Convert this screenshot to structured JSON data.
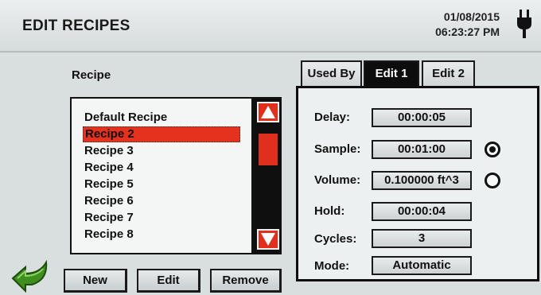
{
  "header": {
    "title": "EDIT RECIPES",
    "date": "01/08/2015",
    "time": "06:23:27 PM"
  },
  "recipe_list": {
    "label": "Recipe",
    "items": [
      "Default Recipe",
      "Recipe 2",
      "Recipe 3",
      "Recipe 4",
      "Recipe 5",
      "Recipe 6",
      "Recipe 7",
      "Recipe 8"
    ],
    "selected": "Recipe 2"
  },
  "buttons": {
    "new": "New",
    "edit": "Edit",
    "remove": "Remove"
  },
  "tabs": [
    {
      "label": "Used By",
      "active": false
    },
    {
      "label": "Edit 1",
      "active": true
    },
    {
      "label": "Edit 2",
      "active": false
    }
  ],
  "fields": [
    {
      "label": "Delay:",
      "value": "00:00:05"
    },
    {
      "label": "Sample:",
      "value": "00:01:00",
      "radio_selected": true
    },
    {
      "label": "Volume:",
      "value": "0.100000 ft^3",
      "radio_selected": false
    },
    {
      "label": "Hold:",
      "value": "00:00:04"
    },
    {
      "label": "Cycles:",
      "value": "3"
    },
    {
      "label": "Mode:",
      "value": "Automatic"
    }
  ],
  "colors": {
    "accent_red": "#e0301d",
    "active_tab": "#0d0d0d",
    "back_arrow_green": "#3f8f1f"
  },
  "icons": {
    "power": "power-plug-icon",
    "back": "back-arrow-icon",
    "scroll_up": "triangle-up-icon",
    "scroll_down": "triangle-down-icon"
  }
}
